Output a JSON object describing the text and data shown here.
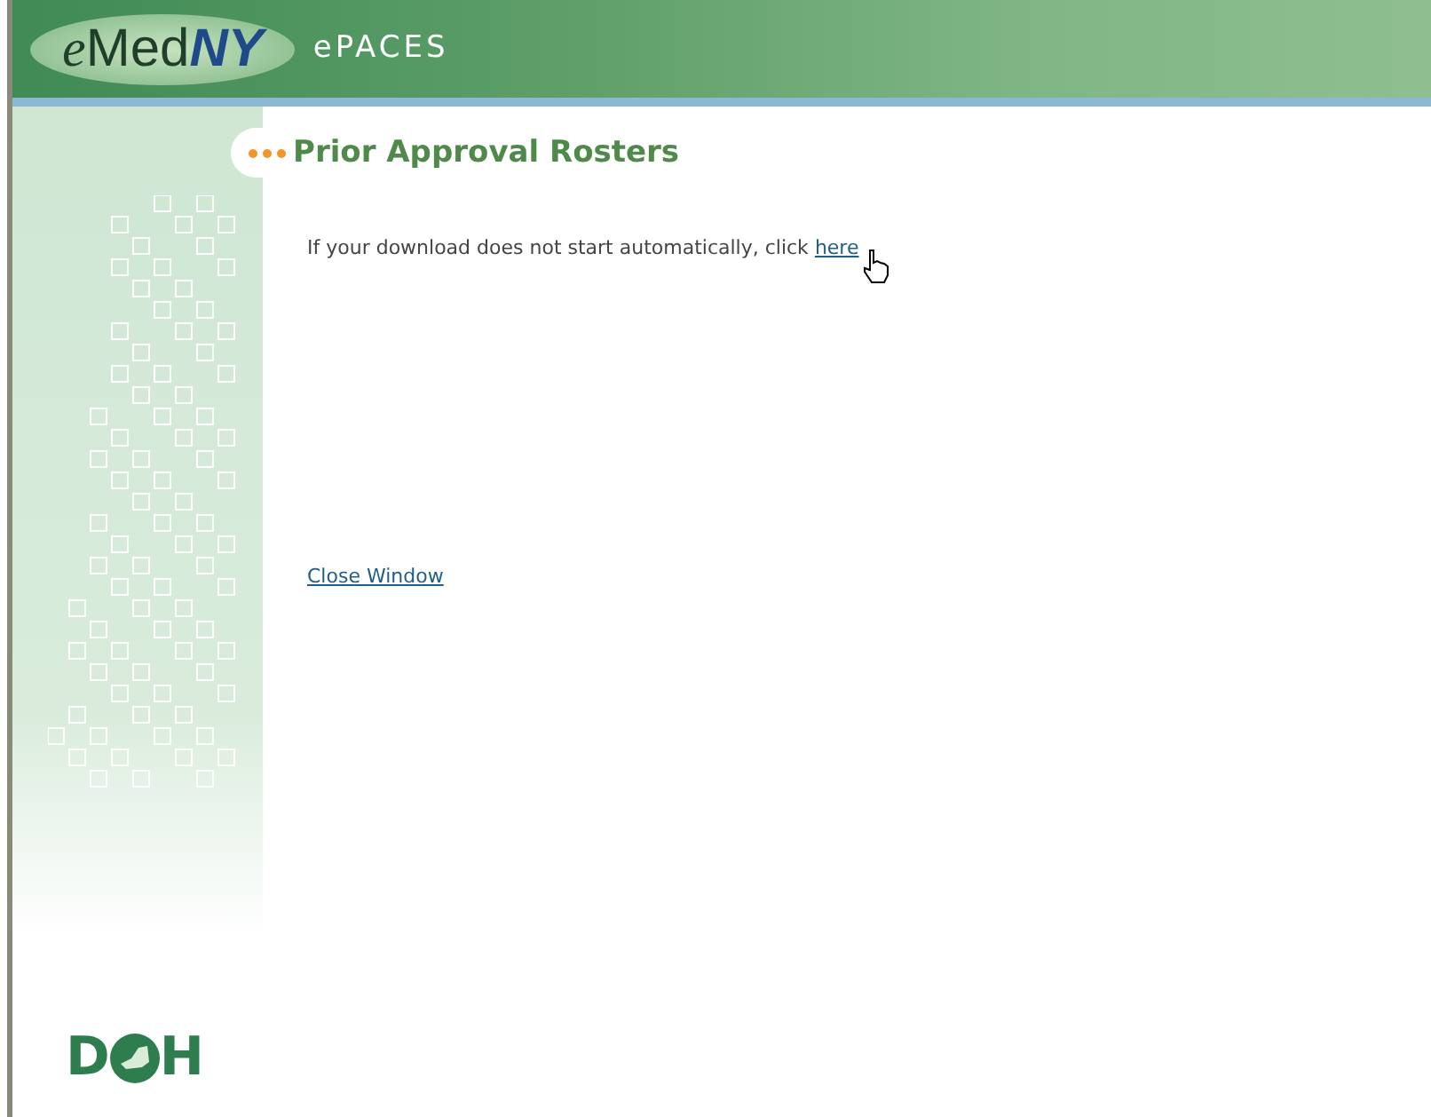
{
  "header": {
    "logo_prefix": "e",
    "logo": "Med**NY**",
    "product": "ePACES"
  },
  "page": {
    "title": "Prior Approval Rosters",
    "message": "If your download does not start automatically, click",
    "download_link": "here",
    "close_link": "Close Window"
  },
  "footer_logo": {
    "left": "D",
    "right": "H"
  }
}
